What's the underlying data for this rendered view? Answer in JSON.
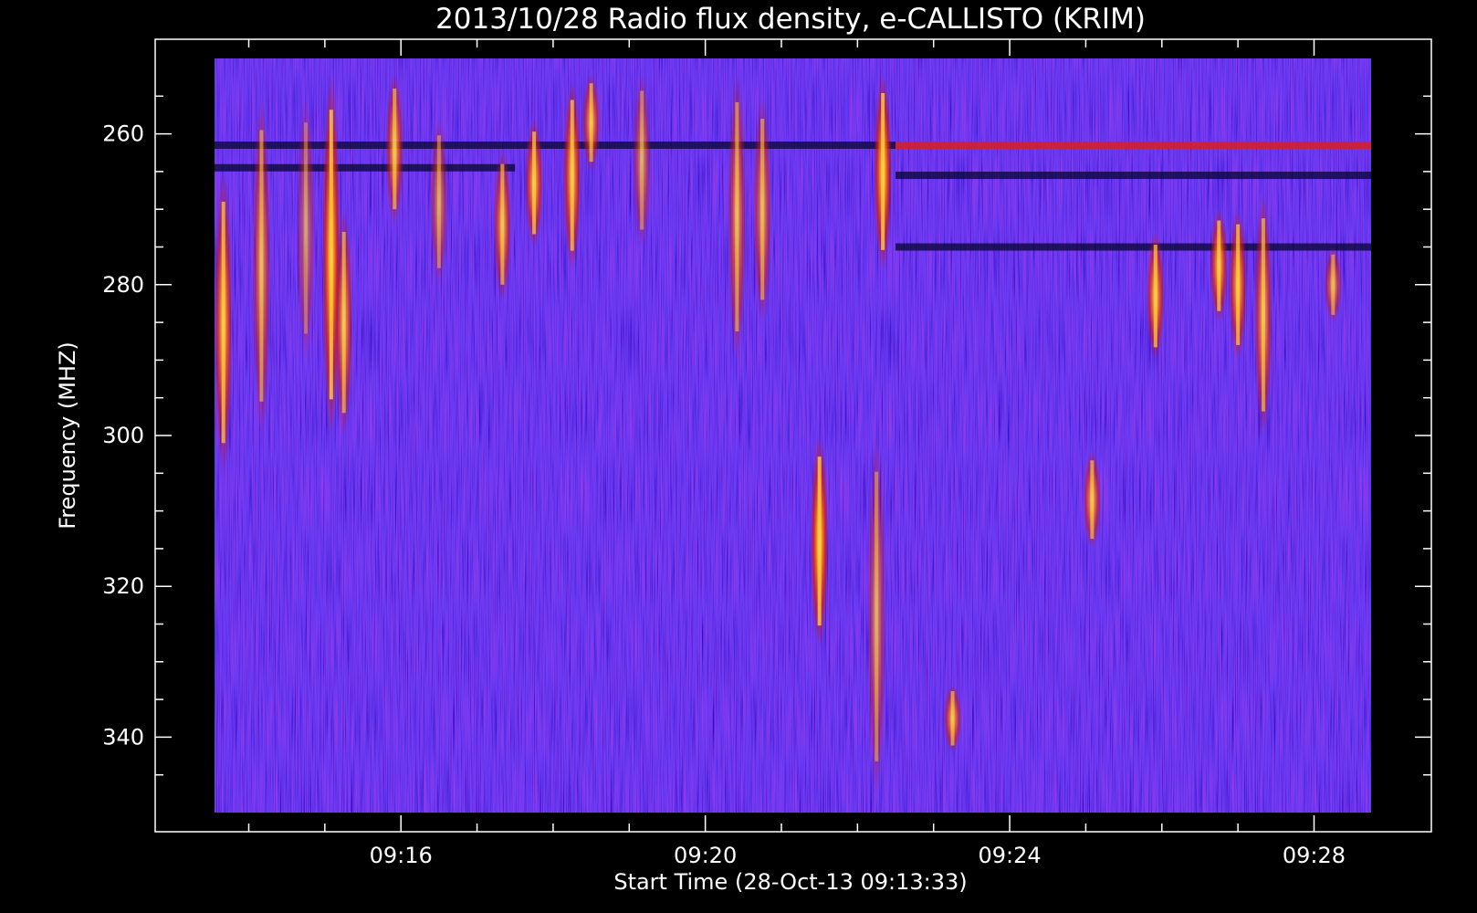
{
  "chart_data": {
    "type": "heatmap",
    "title": "2013/10/28  Radio flux density, e-CALLISTO (KRIM)",
    "xlabel": "Start Time (28-Oct-13 09:13:33)",
    "ylabel": "Frequency (MHZ)",
    "x_unit": "time (HH:MM)",
    "y_unit": "MHz",
    "xlim": [
      "09:13:33",
      "09:28:45"
    ],
    "ylim": [
      350,
      250
    ],
    "y_inverted": true,
    "x_major_ticks": [
      "09:16",
      "09:20",
      "09:24",
      "09:28"
    ],
    "y_major_ticks": [
      260,
      280,
      300,
      320,
      340
    ],
    "colormap": [
      "#000000",
      "#0a0a55",
      "#2323e6",
      "#6a1fb0",
      "#c01818",
      "#ff5010",
      "#ffd040"
    ],
    "background_level_color": "#2323e6",
    "bursts": [
      {
        "t": "09:13:40",
        "f_top": 265,
        "f_bottom": 305,
        "intensity": 0.9
      },
      {
        "t": "09:14:10",
        "f_top": 255,
        "f_bottom": 300,
        "intensity": 0.7
      },
      {
        "t": "09:14:45",
        "f_top": 255,
        "f_bottom": 290,
        "intensity": 0.5
      },
      {
        "t": "09:15:05",
        "f_top": 252,
        "f_bottom": 300,
        "intensity": 1.0
      },
      {
        "t": "09:15:15",
        "f_top": 270,
        "f_bottom": 300,
        "intensity": 0.8
      },
      {
        "t": "09:15:55",
        "f_top": 252,
        "f_bottom": 272,
        "intensity": 0.8
      },
      {
        "t": "09:16:30",
        "f_top": 258,
        "f_bottom": 280,
        "intensity": 0.6
      },
      {
        "t": "09:17:20",
        "f_top": 262,
        "f_bottom": 282,
        "intensity": 0.8
      },
      {
        "t": "09:17:45",
        "f_top": 258,
        "f_bottom": 275,
        "intensity": 0.9
      },
      {
        "t": "09:18:15",
        "f_top": 253,
        "f_bottom": 278,
        "intensity": 0.9
      },
      {
        "t": "09:18:30",
        "f_top": 252,
        "f_bottom": 265,
        "intensity": 0.8
      },
      {
        "t": "09:19:10",
        "f_top": 252,
        "f_bottom": 275,
        "intensity": 0.6
      },
      {
        "t": "09:20:25",
        "f_top": 252,
        "f_bottom": 290,
        "intensity": 0.7
      },
      {
        "t": "09:20:45",
        "f_top": 255,
        "f_bottom": 285,
        "intensity": 0.7
      },
      {
        "t": "09:21:30",
        "f_top": 300,
        "f_bottom": 328,
        "intensity": 1.0
      },
      {
        "t": "09:22:20",
        "f_top": 252,
        "f_bottom": 278,
        "intensity": 1.0
      },
      {
        "t": "09:22:15",
        "f_top": 300,
        "f_bottom": 348,
        "intensity": 0.6
      },
      {
        "t": "09:23:15",
        "f_top": 333,
        "f_bottom": 342,
        "intensity": 0.8
      },
      {
        "t": "09:25:05",
        "f_top": 302,
        "f_bottom": 315,
        "intensity": 0.8
      },
      {
        "t": "09:25:55",
        "f_top": 273,
        "f_bottom": 290,
        "intensity": 0.9
      },
      {
        "t": "09:26:45",
        "f_top": 270,
        "f_bottom": 285,
        "intensity": 0.9
      },
      {
        "t": "09:27:00",
        "f_top": 270,
        "f_bottom": 290,
        "intensity": 0.9
      },
      {
        "t": "09:27:20",
        "f_top": 268,
        "f_bottom": 300,
        "intensity": 0.8
      },
      {
        "t": "09:28:15",
        "f_top": 275,
        "f_bottom": 285,
        "intensity": 0.7
      }
    ],
    "horizontal_bands": [
      {
        "f": 261.5,
        "t_start": "09:13:33",
        "t_end": "09:22:30",
        "level": "dark"
      },
      {
        "f": 264.5,
        "t_start": "09:13:33",
        "t_end": "09:17:30",
        "level": "dark"
      },
      {
        "f": 261.5,
        "t_start": "09:22:30",
        "t_end": "09:28:45",
        "level": "hot"
      },
      {
        "f": 265.5,
        "t_start": "09:22:30",
        "t_end": "09:28:45",
        "level": "dark"
      },
      {
        "f": 275.0,
        "t_start": "09:22:30",
        "t_end": "09:28:45",
        "level": "dark"
      }
    ]
  }
}
